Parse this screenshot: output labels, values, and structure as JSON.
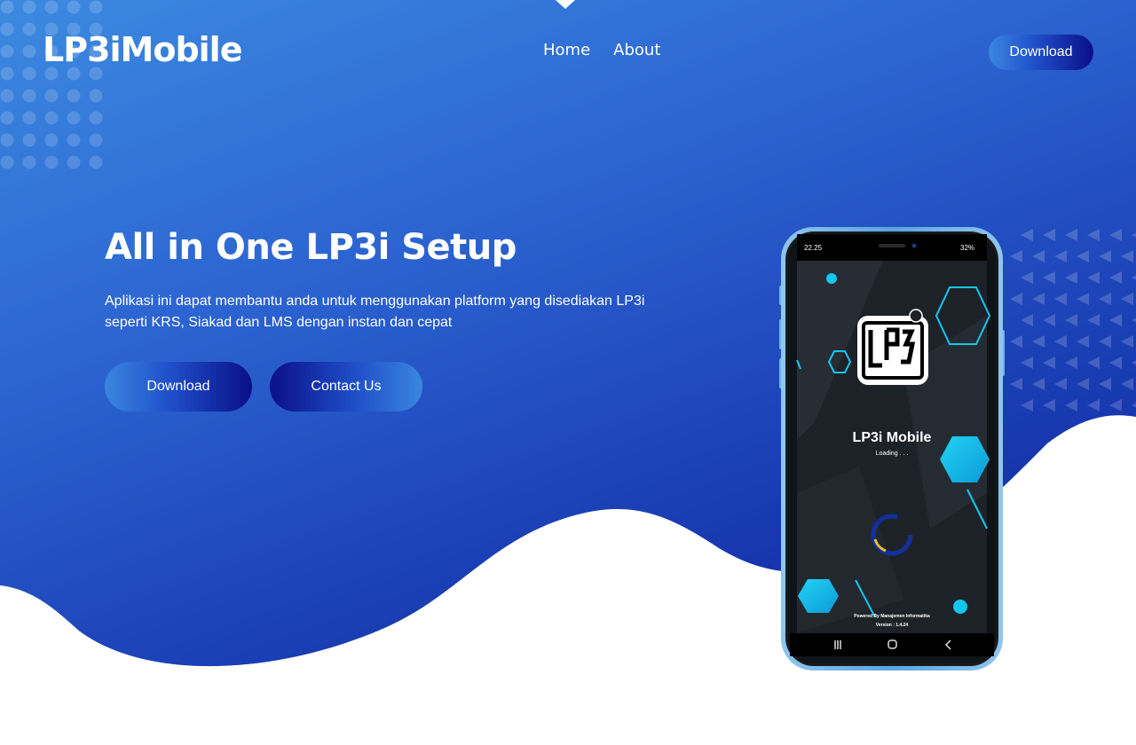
{
  "header": {
    "logo": "LP3iMobile",
    "nav": [
      "Home",
      "About"
    ],
    "download_label": "Download"
  },
  "hero": {
    "title": "All in One LP3i Setup",
    "description": "Aplikasi ini dapat membantu anda untuk menggunakan platform yang disediakan LP3i seperti KRS, Siakad dan LMS dengan instan dan cepat",
    "download_label": "Download",
    "contact_label": "Contact Us"
  },
  "phone_screen": {
    "status_time": "22.25",
    "status_battery": "32%",
    "app_name": "LP3i Mobile",
    "loading_text": "Loading . . .",
    "powered_by": "Powered By Manajemen Informatika",
    "version": "Version : 1.4.24"
  },
  "colors": {
    "gradient_light": "#3c8ae0",
    "gradient_dark": "#0b1a98",
    "button_dark": "#0a0f88",
    "accent_cyan": "#12c6f0"
  }
}
